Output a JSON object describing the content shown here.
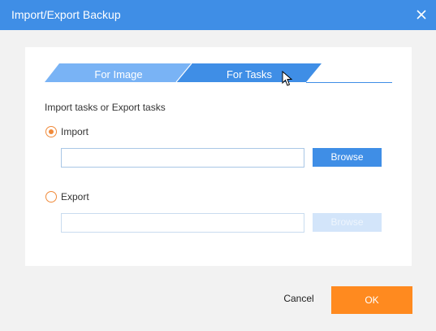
{
  "window": {
    "title": "Import/Export Backup",
    "close_icon": "close-icon"
  },
  "tabs": [
    {
      "label": "For Image",
      "selected": false
    },
    {
      "label": "For Tasks",
      "selected": true
    }
  ],
  "section_heading": "Import tasks or Export tasks",
  "options": {
    "import": {
      "label": "Import",
      "checked": true,
      "path_value": "",
      "browse_label": "Browse",
      "browse_enabled": true
    },
    "export": {
      "label": "Export",
      "checked": false,
      "path_value": "",
      "browse_label": "Browse",
      "browse_enabled": false
    }
  },
  "footer": {
    "cancel_label": "Cancel",
    "ok_label": "OK"
  },
  "colors": {
    "accent_blue": "#3f8ee6",
    "tab_inactive_blue": "#79b3f5",
    "radio_orange": "#f08a3a",
    "ok_orange": "#ff8a1f",
    "disabled_blue": "#d3e5fa"
  }
}
